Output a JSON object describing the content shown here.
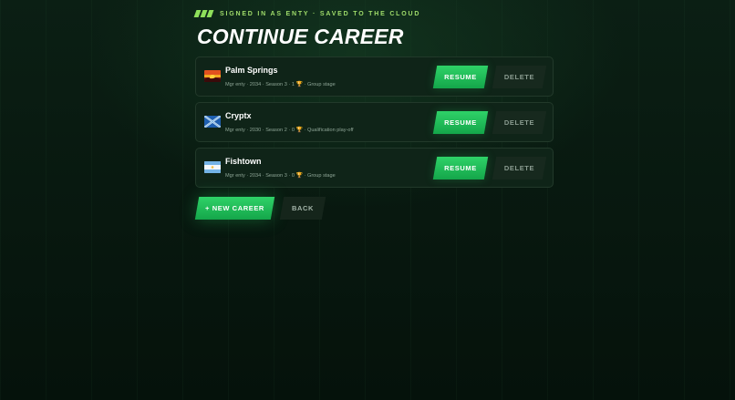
{
  "status": {
    "text": "SIGNED IN AS ENTY · SAVED TO THE CLOUD",
    "accent_color": "#8fe05b"
  },
  "page_title": "CONTINUE CAREER",
  "careers": [
    {
      "name": "Palm Springs",
      "flag_icon": "sunset-flag-icon",
      "manager": "Mgr enty",
      "year": "2034",
      "season": "Season 3",
      "trophies": "1",
      "stage": "Group stage",
      "resume_label": "RESUME",
      "delete_label": "DELETE"
    },
    {
      "name": "Cryptx",
      "flag_icon": "blue-saltire-flag-icon",
      "manager": "Mgr enty",
      "year": "2030",
      "season": "Season 2",
      "trophies": "0",
      "stage": "Qualification play-off",
      "resume_label": "RESUME",
      "delete_label": "DELETE"
    },
    {
      "name": "Fishtown",
      "flag_icon": "light-blue-stripes-flag-icon",
      "manager": "Mgr enty",
      "year": "2034",
      "season": "Season 3",
      "trophies": "0",
      "stage": "Group stage",
      "resume_label": "RESUME",
      "delete_label": "DELETE"
    }
  ],
  "actions": {
    "new_career_label": "+ NEW CAREER",
    "back_label": "BACK"
  },
  "meta_separator": " · ",
  "trophy_icon": "trophy-icon",
  "colors": {
    "primary": "#1fbf58",
    "background": "#06140d",
    "card": "#0f2418"
  }
}
